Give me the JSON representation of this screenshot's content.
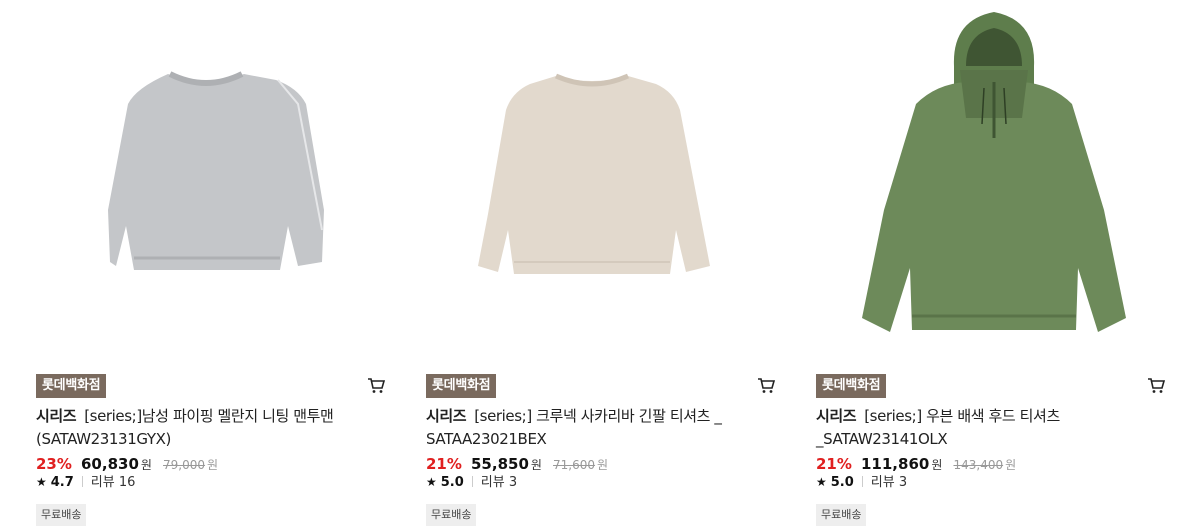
{
  "products": [
    {
      "store_badge": "롯데백화점",
      "brand": "시리즈",
      "name_line1": "[series;]남성 파이핑 멜란지 니팅 맨투맨",
      "name_line2": "(SATAW23131GYX)",
      "discount": "23%",
      "price": "60,830",
      "currency": "원",
      "original_price": "79,000",
      "original_currency": "원",
      "rating": "4.7",
      "review_label": "리뷰 16",
      "shipping": "무료배송",
      "colors": {
        "garment": "#c4c6c9",
        "shade": "#aeb0b3"
      }
    },
    {
      "store_badge": "롯데백화점",
      "brand": "시리즈",
      "name_line1": "[series;] 크루넥 사카리바 긴팔 티셔츠 _",
      "name_line2": "SATAA23021BEX",
      "discount": "21%",
      "price": "55,850",
      "currency": "원",
      "original_price": "71,600",
      "original_currency": "원",
      "rating": "5.0",
      "review_label": "리뷰 3",
      "shipping": "무료배송",
      "colors": {
        "garment": "#e2d9cd",
        "shade": "#cfc4b6"
      }
    },
    {
      "store_badge": "롯데백화점",
      "brand": "시리즈",
      "name_line1": "[series;] 우븐 배색 후드 티셔츠",
      "name_line2": "_SATAW23141OLX",
      "discount": "21%",
      "price": "111,860",
      "currency": "원",
      "original_price": "143,400",
      "original_currency": "원",
      "rating": "5.0",
      "review_label": "리뷰 3",
      "shipping": "무료배송",
      "colors": {
        "garment": "#6d8a5a",
        "shade": "#5a7449"
      }
    }
  ],
  "icons": {
    "cart": "cart-icon",
    "star": "star-icon"
  },
  "theme": {
    "badge_bg": "#7a6a5e",
    "discount": "#e02020"
  }
}
